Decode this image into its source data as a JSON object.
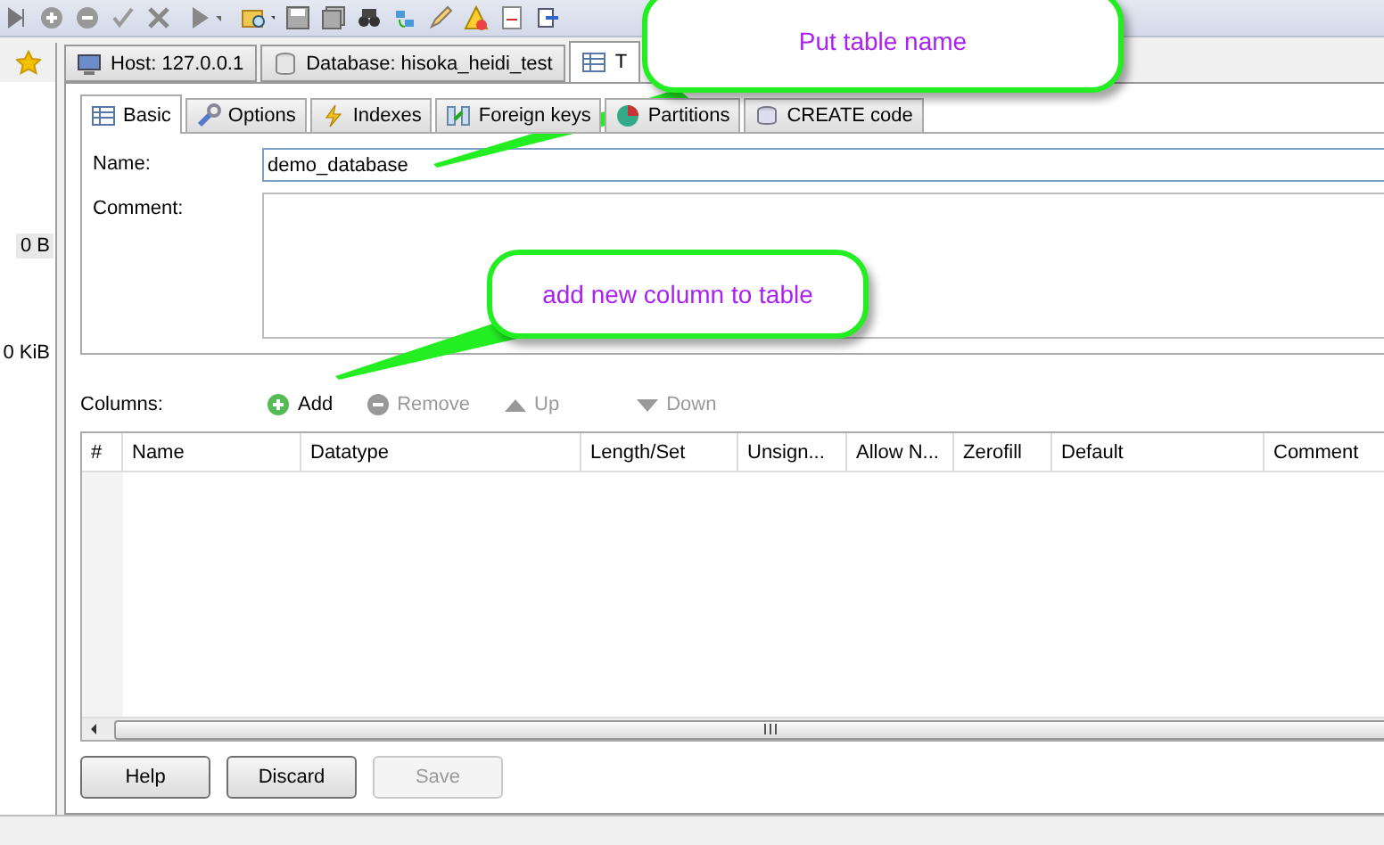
{
  "sidebar": {
    "sizes": [
      "0 B",
      "0 KiB"
    ]
  },
  "main_tabs": [
    {
      "label": "Host: 127.0.0.1",
      "kind": "host",
      "selected": false
    },
    {
      "label": "Database: hisoka_heidi_test",
      "kind": "database",
      "selected": false
    },
    {
      "label": "T",
      "kind": "table",
      "selected": true
    }
  ],
  "editor_tabs": [
    {
      "label": "Basic",
      "kind": "table",
      "selected": true
    },
    {
      "label": "Options",
      "kind": "wrench",
      "selected": false
    },
    {
      "label": "Indexes",
      "kind": "bolt",
      "selected": false
    },
    {
      "label": "Foreign keys",
      "kind": "keys",
      "selected": false
    },
    {
      "label": "Partitions",
      "kind": "pie",
      "selected": false
    },
    {
      "label": "CREATE code",
      "kind": "code",
      "selected": false
    }
  ],
  "name_field": {
    "label": "Name:",
    "value": "demo_database"
  },
  "comment_field": {
    "label": "Comment:"
  },
  "columns_toolbar": {
    "label": "Columns:",
    "buttons": [
      {
        "label": "Add",
        "kind": "add",
        "disabled": false
      },
      {
        "label": "Remove",
        "kind": "remove",
        "disabled": true
      },
      {
        "label": "Up",
        "kind": "up",
        "disabled": true
      },
      {
        "label": "Down",
        "kind": "down",
        "disabled": true
      }
    ]
  },
  "table": {
    "columns": [
      "#",
      "Name",
      "Datatype",
      "Length/Set",
      "Unsign...",
      "Allow N...",
      "Zerofill",
      "Default",
      "Comment"
    ]
  },
  "buttons": [
    {
      "label": "Help",
      "disabled": false
    },
    {
      "label": "Discard",
      "disabled": false
    },
    {
      "label": "Save",
      "disabled": true
    }
  ],
  "callouts": [
    {
      "text": "Put table name"
    },
    {
      "text": "add new column to table"
    }
  ]
}
